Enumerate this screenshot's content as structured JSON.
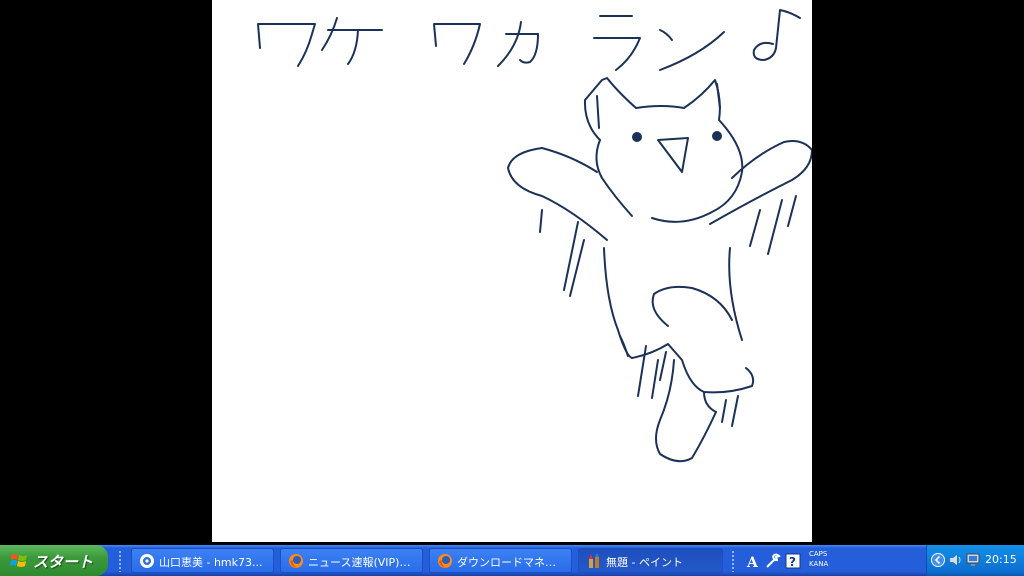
{
  "canvas": {
    "handwritten_text": "ワケワカラン♪"
  },
  "taskbar": {
    "start_label": "スタート",
    "tasks": [
      {
        "label": "山口恵美 - hmk73...",
        "icon": "messenger-icon"
      },
      {
        "label": "ニュース速報(VIP)@...",
        "icon": "firefox-icon"
      },
      {
        "label": "ダウンロードマネージャ",
        "icon": "firefox-icon"
      },
      {
        "label": "無題 - ペイント",
        "icon": "paint-icon"
      }
    ],
    "ime": {
      "caps": "CAPS",
      "kana": "KANA"
    },
    "clock": "20:15"
  },
  "colors": {
    "taskbar": "#245edb",
    "start": "#3b9a3b",
    "tray": "#0c6fd2",
    "ink": "#1c3157"
  }
}
